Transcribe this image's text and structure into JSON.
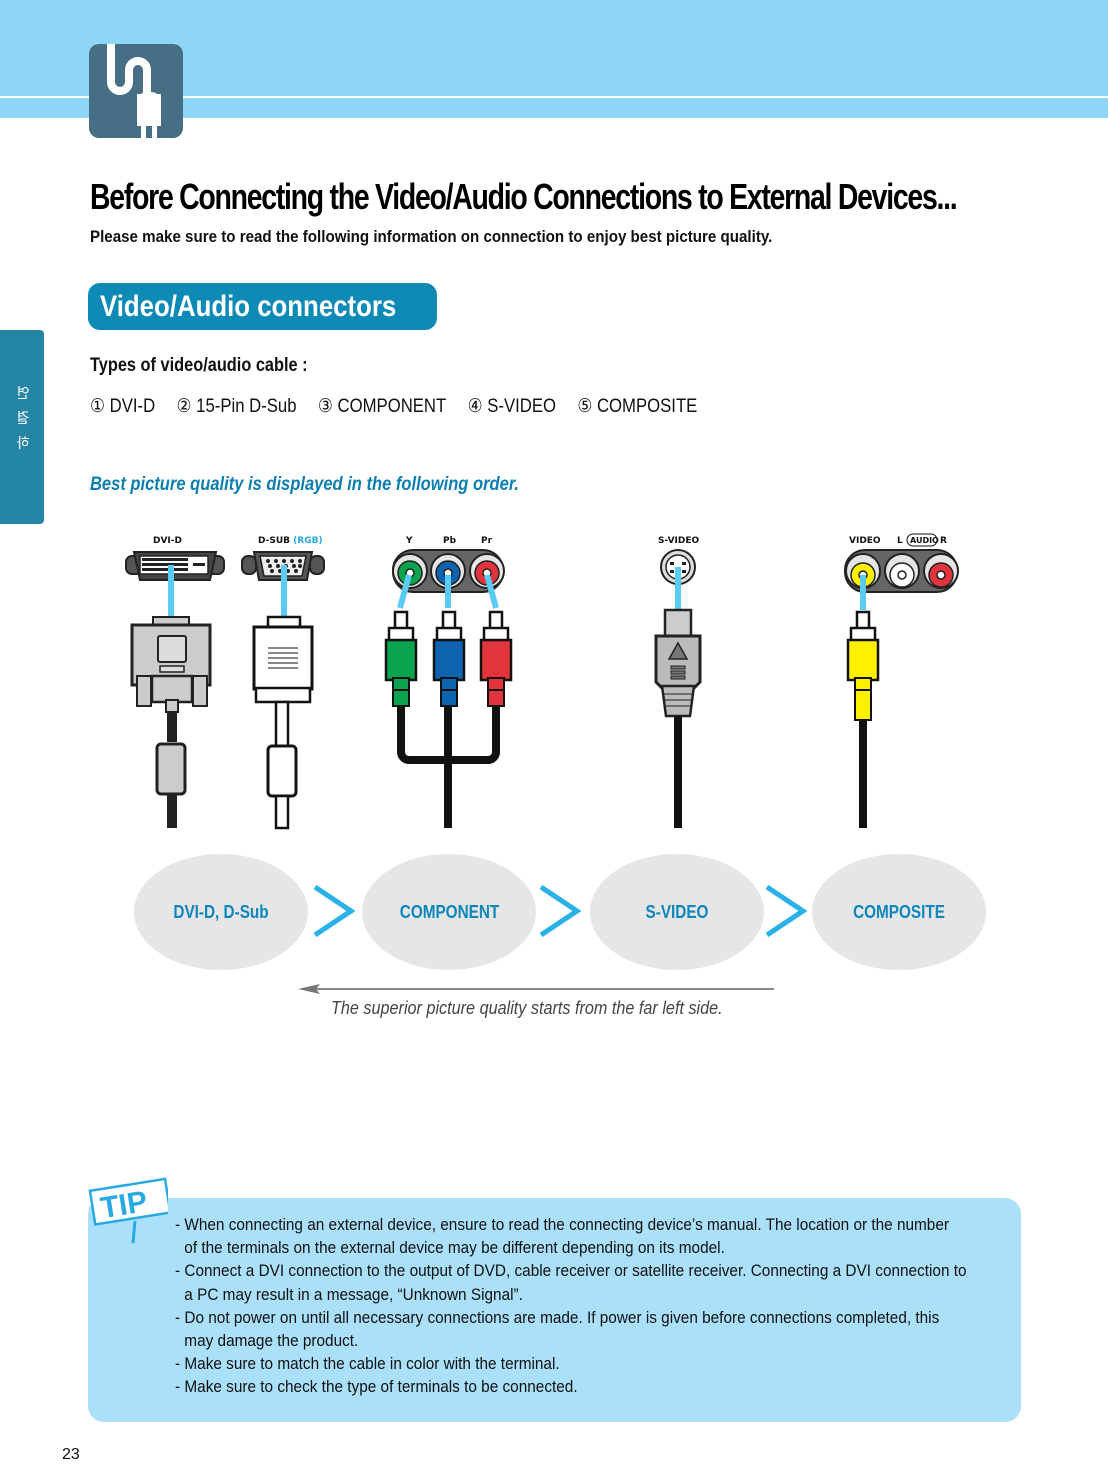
{
  "header": {
    "logo_icon": "plug-cable-icon"
  },
  "side_tab": {
    "label_lines": [
      "연",
      "결",
      "하"
    ]
  },
  "title": "Before Connecting the Video/Audio Connections to External Devices...",
  "subtitle": "Please make sure to read the following information on connection to enjoy best picture quality.",
  "section": {
    "badge": "Video/Audio connectors",
    "types_label": "Types of video/audio cable :",
    "types": [
      "① DVI-D",
      "② 15-Pin D-Sub",
      "③ COMPONENT",
      "④ S-VIDEO",
      "⑤ COMPOSITE"
    ],
    "order_label": "Best picture quality is displayed in the following order."
  },
  "diagram": {
    "ports": {
      "dvi": "DVI-D",
      "dsub": "D-SUB",
      "dsub_suffix": "(RGB)",
      "component_y": "Y",
      "component_pb": "Pb",
      "component_pr": "Pr",
      "svideo": "S-VIDEO",
      "video": "VIDEO",
      "audio_l": "L",
      "audio": "AUDIO",
      "audio_r": "R"
    },
    "colors": {
      "link_line": "#5ccbf3",
      "component_y": "#0ba34e",
      "component_pb": "#0d63ad",
      "component_pr": "#e2343c",
      "composite_video": "#fff000",
      "audio_r": "#e2343c"
    }
  },
  "ranking": {
    "items": [
      "DVI-D, D-Sub",
      "COMPONENT",
      "S-VIDEO",
      "COMPOSITE"
    ],
    "separator": ">",
    "caption": "The superior picture quality starts from the far left side."
  },
  "tip": {
    "badge": "TIP",
    "items": [
      "- When connecting an external device, ensure to read the connecting device’s manual. The location or the number",
      "  of the terminals on the external device may be different depending on its model.",
      "- Connect a DVI connection to the output of DVD, cable receiver or satellite receiver. Connecting a DVI connection to",
      "  a PC may result in a message, “Unknown Signal”.",
      "- Do not power on until all necessary connections are made. If power is given before connections completed, this",
      "  may damage the product.",
      "- Make sure to match the cable in color with the terminal.",
      "- Make sure to check the type of terminals to be connected."
    ]
  },
  "page_number": "23"
}
